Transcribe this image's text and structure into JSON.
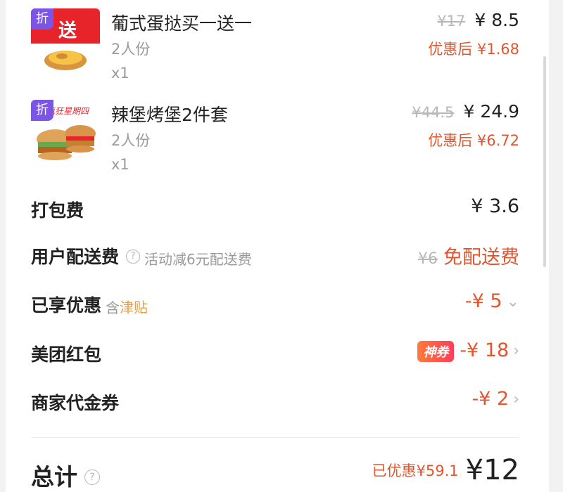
{
  "items": [
    {
      "badge": "折",
      "image_text": "送",
      "name": "葡式蛋挞买一送一",
      "spec": "2人份",
      "qty": "x1",
      "orig_price": "¥17",
      "price": "¥ 8.5",
      "after_label": "优惠后 ¥1.68"
    },
    {
      "badge": "折",
      "image_text": "疯狂星期四",
      "name": "辣堡烤堡2件套",
      "spec": "2人份",
      "qty": "x1",
      "orig_price": "¥44.5",
      "price": "¥ 24.9",
      "after_label": "优惠后 ¥6.72"
    }
  ],
  "fees": {
    "packing": {
      "label": "打包费",
      "value": "¥ 3.6"
    },
    "delivery": {
      "label": "用户配送费",
      "note": "活动减6元配送费",
      "orig": "¥6",
      "value": "免配送费"
    },
    "discount": {
      "label": "已享优惠",
      "note_prefix": "含",
      "note_highlight": "津贴",
      "value": "-¥ 5"
    },
    "redpacket": {
      "label": "美团红包",
      "tag": "神券",
      "value": "-¥ 18"
    },
    "voucher": {
      "label": "商家代金券",
      "value": "-¥ 2"
    }
  },
  "total": {
    "label": "总计",
    "saved": "已优惠¥59.1",
    "value": "¥12"
  },
  "colors": {
    "accent_red": "#e2562f",
    "badge_purple": "#7d55e6",
    "subsidy_orange": "#e0a04a"
  }
}
